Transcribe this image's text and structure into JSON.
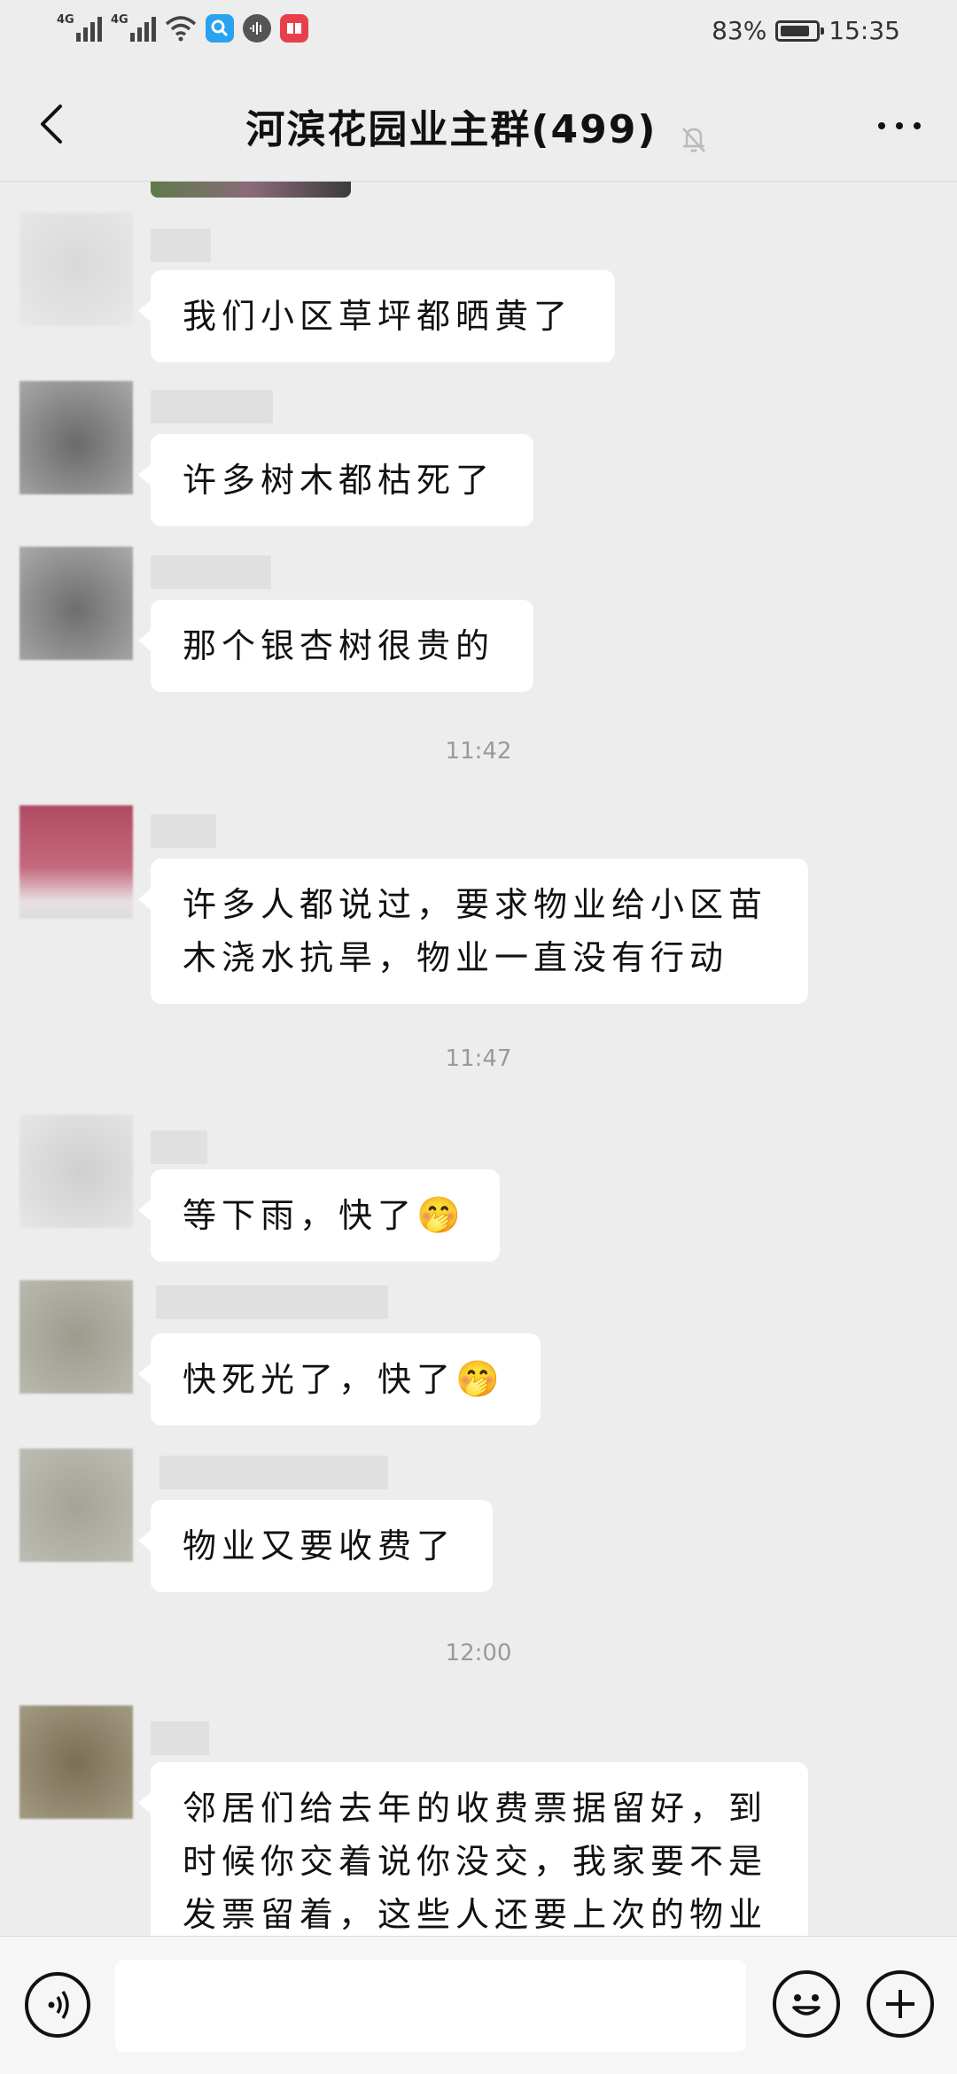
{
  "status_bar": {
    "network_1": "4G",
    "network_2": "4G",
    "battery": "83%",
    "battery_level": 0.83,
    "time": "15:35"
  },
  "header": {
    "title": "河滨花园业主群(499)"
  },
  "messages": [
    {
      "text": "我们小区草坪都晒黄了"
    },
    {
      "text": "许多树木都枯死了"
    },
    {
      "text": "那个银杏树很贵的"
    },
    {
      "text": "许多人都说过，要求物业给小区苗木浇水抗旱，物业一直没有行动"
    },
    {
      "text": "等下雨，快了",
      "emoji": "🤭"
    },
    {
      "text": "快死光了，快了",
      "emoji": "🤭"
    },
    {
      "text": "物业又要收费了"
    },
    {
      "text": "邻居们给去年的收费票据留好，到时候你交着说你没交，我家要不是发票留着，这些人还要上次的物业"
    }
  ],
  "timestamps": [
    "11:42",
    "11:47",
    "12:00"
  ],
  "input": {
    "placeholder": ""
  },
  "icons": {
    "back": "chevron-left",
    "mute": "bell-off",
    "more": "ellipsis",
    "voice": "voice-wave",
    "emoji": "smiley",
    "plus": "plus-circle"
  },
  "colors": {
    "background": "#ededed",
    "bubble": "#ffffff"
  }
}
